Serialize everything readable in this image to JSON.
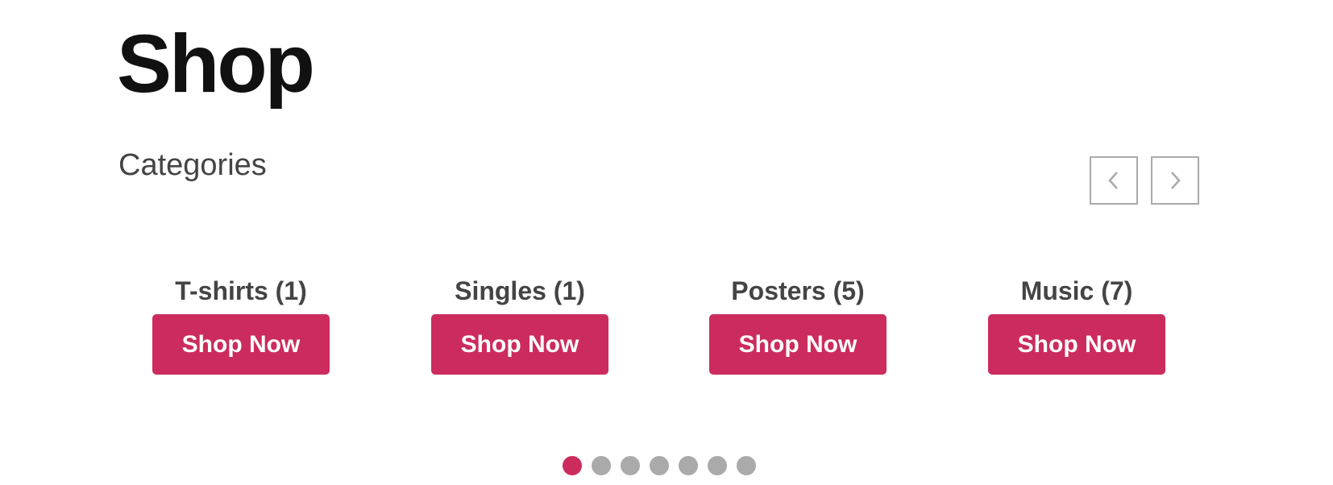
{
  "page": {
    "title": "Shop"
  },
  "section": {
    "title": "Categories"
  },
  "carousel": {
    "prev_icon": "chevron-left-icon",
    "next_icon": "chevron-right-icon",
    "active_index": 0,
    "page_count": 7,
    "colors": {
      "accent": "#cc2c5d",
      "inactive_dot": "#aaaaaa",
      "arrow_border": "#aaaaaa"
    }
  },
  "categories": [
    {
      "label": "T-shirts (1)",
      "button_label": "Shop Now"
    },
    {
      "label": "Singles (1)",
      "button_label": "Shop Now"
    },
    {
      "label": "Posters (5)",
      "button_label": "Shop Now"
    },
    {
      "label": "Music (7)",
      "button_label": "Shop Now"
    }
  ]
}
